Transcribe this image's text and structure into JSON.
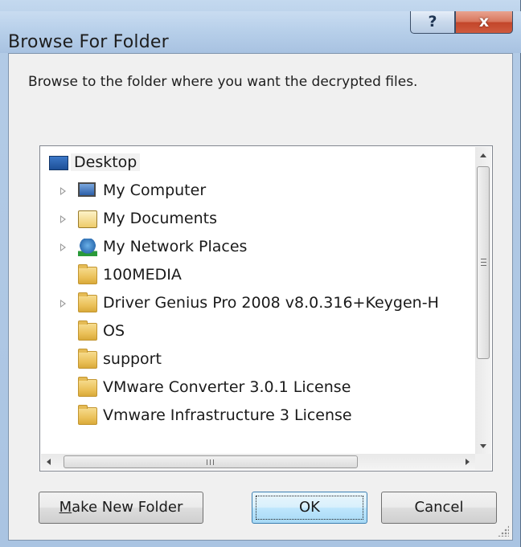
{
  "window": {
    "title": "Browse For Folder",
    "help_glyph": "?",
    "close_glyph": "x"
  },
  "prompt": "Browse to the folder where you want the decrypted files.",
  "tree": {
    "items": [
      {
        "label": "Desktop",
        "icon": "desktop-icon",
        "expander": false,
        "level": 0
      },
      {
        "label": "My Computer",
        "icon": "computer-icon",
        "expander": true,
        "level": 1
      },
      {
        "label": "My Documents",
        "icon": "documents-icon",
        "expander": true,
        "level": 1
      },
      {
        "label": "My Network Places",
        "icon": "network-icon",
        "expander": true,
        "level": 1
      },
      {
        "label": "100MEDIA",
        "icon": "folder-icon",
        "expander": false,
        "level": 1
      },
      {
        "label": "Driver Genius Pro 2008 v8.0.316+Keygen-H",
        "icon": "folder-icon",
        "expander": true,
        "level": 1
      },
      {
        "label": "OS",
        "icon": "folder-icon",
        "expander": false,
        "level": 1
      },
      {
        "label": "support",
        "icon": "folder-icon",
        "expander": false,
        "level": 1
      },
      {
        "label": "VMware Converter 3.0.1 License",
        "icon": "folder-icon",
        "expander": false,
        "level": 1
      },
      {
        "label": "Vmware Infrastructure 3 License",
        "icon": "folder-icon",
        "expander": false,
        "level": 1
      }
    ],
    "selected": "Desktop"
  },
  "buttons": {
    "make_new_folder": "Make New Folder",
    "ok": "OK",
    "cancel": "Cancel"
  }
}
